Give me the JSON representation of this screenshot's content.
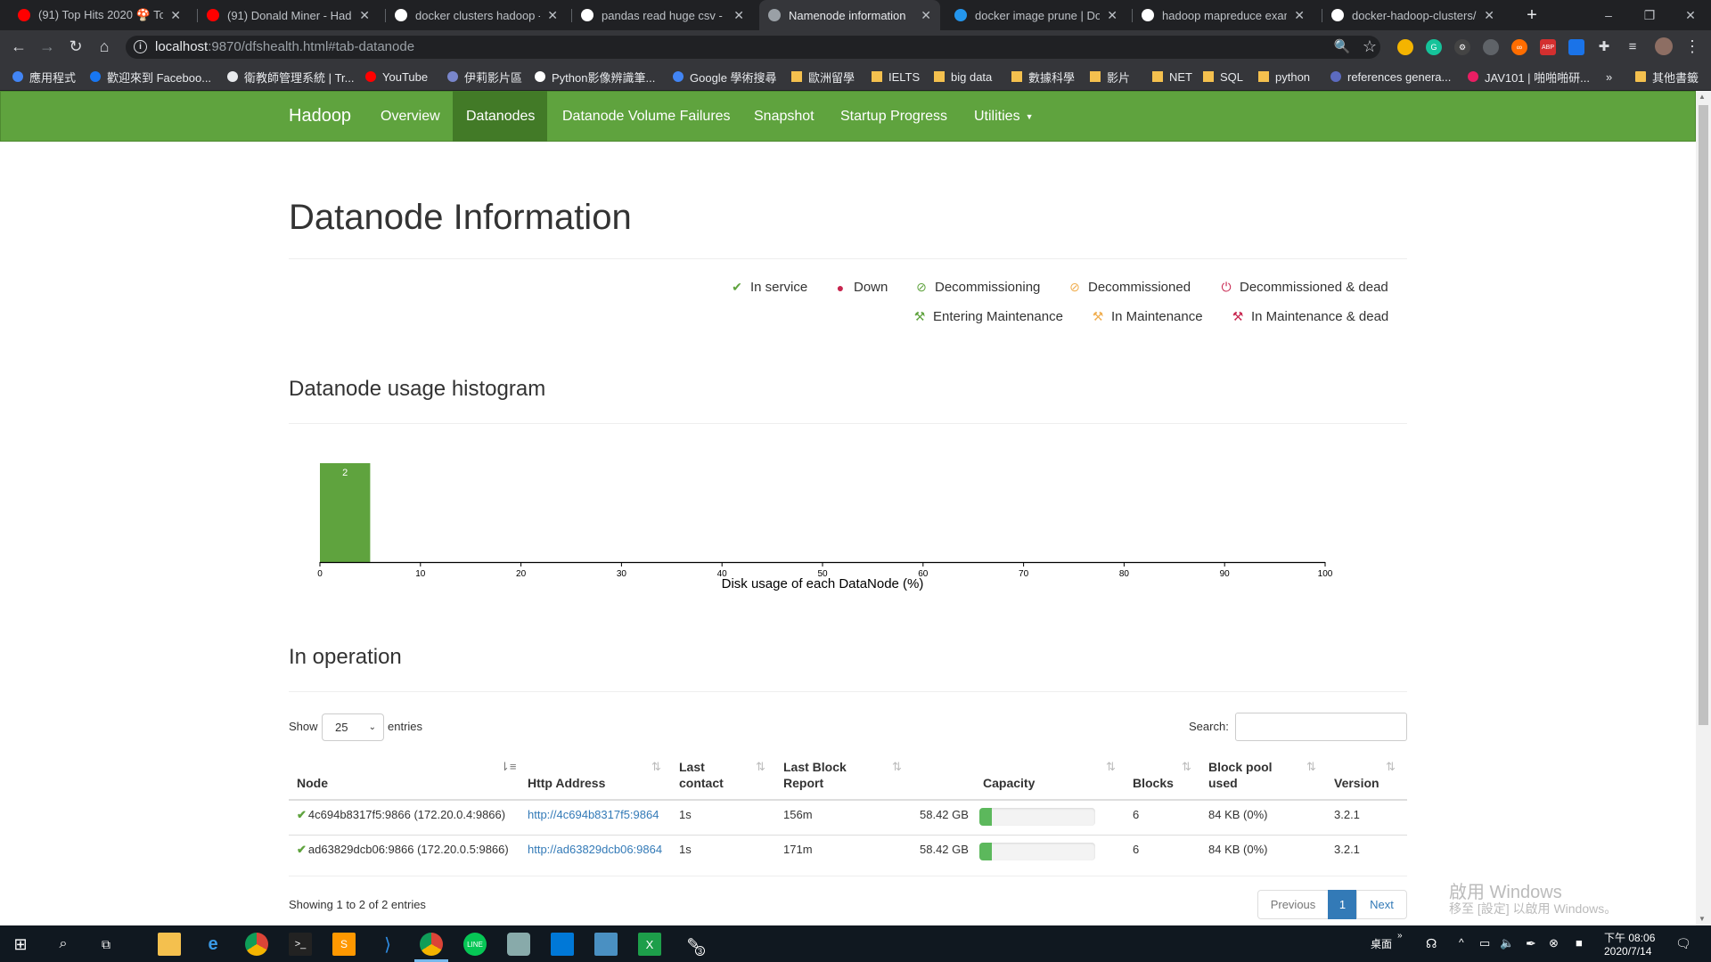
{
  "browser": {
    "tabs": [
      {
        "title": "(91) Top Hits 2020 🍄 Top",
        "icon": "youtube-icon",
        "color": "#ff0000"
      },
      {
        "title": "(91) Donald Miner - Hado",
        "icon": "youtube-icon",
        "color": "#ff0000"
      },
      {
        "title": "docker clusters hadoop - G",
        "icon": "google-icon",
        "color": "#ffffff"
      },
      {
        "title": "pandas read huge csv - Go",
        "icon": "google-icon",
        "color": "#ffffff"
      },
      {
        "title": "Namenode information",
        "icon": "globe-icon",
        "color": "#9aa0a6",
        "active": true
      },
      {
        "title": "docker image prune | Doc",
        "icon": "docker-icon",
        "color": "#2496ed"
      },
      {
        "title": "hadoop mapreduce exam",
        "icon": "google-icon",
        "color": "#ffffff"
      },
      {
        "title": "docker-hadoop-clusters/d",
        "icon": "github-icon",
        "color": "#ffffff"
      }
    ],
    "url_host": "localhost",
    "url_rest": ":9870/dfshealth.html#tab-datanode",
    "bookmarks": [
      {
        "label": "應用程式",
        "icon": "apps-grid-icon"
      },
      {
        "label": "歡迎來到 Faceboo...",
        "icon": "facebook-icon"
      },
      {
        "label": "衛教師管理系統 | Tr...",
        "icon": "globe-icon"
      },
      {
        "label": "YouTube",
        "icon": "youtube-icon"
      },
      {
        "label": "伊莉影片區",
        "icon": "site-icon"
      },
      {
        "label": "Python影像辨識筆...",
        "icon": "medium-icon"
      },
      {
        "label": "Google 學術搜尋",
        "icon": "scholar-icon"
      },
      {
        "label": "歐洲留學",
        "icon": "folder-icon"
      },
      {
        "label": "IELTS",
        "icon": "folder-icon"
      },
      {
        "label": "big data",
        "icon": "folder-icon"
      },
      {
        "label": "數據科學",
        "icon": "folder-icon"
      },
      {
        "label": "影片",
        "icon": "folder-icon"
      },
      {
        "label": "NET",
        "icon": "folder-icon"
      },
      {
        "label": "SQL",
        "icon": "folder-icon"
      },
      {
        "label": "python",
        "icon": "folder-icon"
      },
      {
        "label": "references genera...",
        "icon": "doc-icon"
      },
      {
        "label": "JAV101 | 啪啪啪研...",
        "icon": "heart-icon"
      }
    ],
    "bookmarks_more": "»",
    "other_bookmarks": "其他書籤"
  },
  "nav": {
    "brand": "Hadoop",
    "items": [
      "Overview",
      "Datanodes",
      "Datanode Volume Failures",
      "Snapshot",
      "Startup Progress",
      "Utilities"
    ],
    "active": "Datanodes"
  },
  "page": {
    "title": "Datanode Information",
    "legend": [
      {
        "label": "In service",
        "icon": "check-icon",
        "color": "#5fa33e"
      },
      {
        "label": "Down",
        "icon": "exclamation-circle-icon",
        "color": "#c7254e"
      },
      {
        "label": "Decommissioning",
        "icon": "ban-icon",
        "color": "#5fa33e"
      },
      {
        "label": "Decommissioned",
        "icon": "ban-icon",
        "color": "#f0ad4e"
      },
      {
        "label": "Decommissioned & dead",
        "icon": "power-icon",
        "color": "#c7254e"
      },
      {
        "label": "Entering Maintenance",
        "icon": "wrench-icon",
        "color": "#5fa33e"
      },
      {
        "label": "In Maintenance",
        "icon": "wrench-icon",
        "color": "#f0ad4e"
      },
      {
        "label": "In Maintenance & dead",
        "icon": "wrench-icon",
        "color": "#c7254e"
      }
    ],
    "histogram_heading": "Datanode usage histogram",
    "operation_heading": "In operation"
  },
  "chart_data": {
    "type": "bar",
    "bins": [
      {
        "x0": 0,
        "x1": 5,
        "count": 2
      }
    ],
    "xlim": [
      0,
      100
    ],
    "xticks": [
      0,
      10,
      20,
      30,
      40,
      50,
      60,
      70,
      80,
      90,
      100
    ],
    "xlabel": "Disk usage of each DataNode (%)",
    "bar_color": "#5fa33e"
  },
  "table": {
    "show_label": "Show",
    "page_size": "25",
    "entries_label": "entries",
    "search_label": "Search:",
    "columns": [
      "Node",
      "Http Address",
      "Last contact",
      "Last Block Report",
      "Capacity",
      "Blocks",
      "Block pool used",
      "Version"
    ],
    "rows": [
      {
        "node": "4c694b8317f5:9866 (172.20.0.4:9866)",
        "http": "http://4c694b8317f5:9864",
        "last_contact": "1s",
        "last_block_report": "156m",
        "capacity": "58.42 GB",
        "capacity_used_fraction": 0.11,
        "blocks": "6",
        "block_pool_used": "84 KB (0%)",
        "version": "3.2.1"
      },
      {
        "node": "ad63829dcb06:9866 (172.20.0.5:9866)",
        "http": "http://ad63829dcb06:9864",
        "last_contact": "1s",
        "last_block_report": "171m",
        "capacity": "58.42 GB",
        "capacity_used_fraction": 0.11,
        "blocks": "6",
        "block_pool_used": "84 KB (0%)",
        "version": "3.2.1"
      }
    ],
    "info": "Showing 1 to 2 of 2 entries",
    "prev": "Previous",
    "page": "1",
    "next": "Next"
  },
  "watermark": {
    "line1": "啟用 Windows",
    "line2": "移至 [設定] 以啟用 Windows。"
  },
  "taskbar": {
    "ime": "桌面",
    "time": "下午 08:06",
    "date": "2020/7/14",
    "badge": "3"
  }
}
